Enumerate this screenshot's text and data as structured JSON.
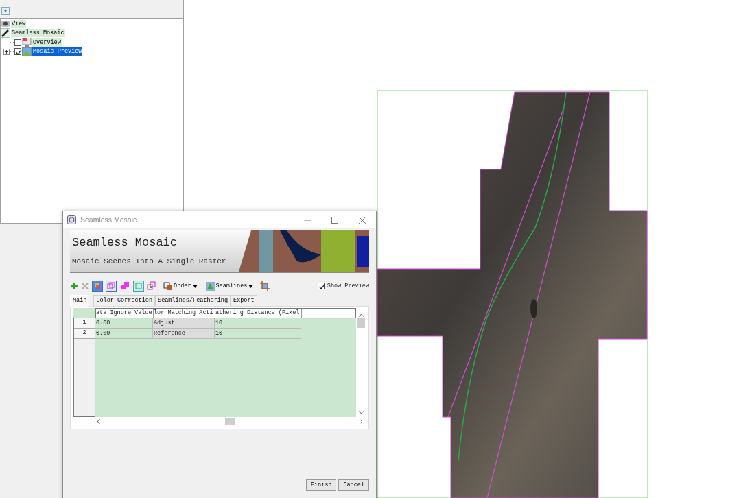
{
  "layer_manager": {
    "tree": [
      {
        "label": "View",
        "kind": "view"
      },
      {
        "label": "Seamless Mosaic",
        "kind": "tool",
        "children": [
          {
            "label": "Overview",
            "kind": "overview",
            "checked": false,
            "selected": false
          },
          {
            "label": "Mosaic Preview",
            "kind": "preview",
            "checked": true,
            "selected": true
          }
        ]
      }
    ]
  },
  "dialog": {
    "title": "Seamless Mosaic",
    "banner": {
      "title": "Seamless Mosaic",
      "subtitle": "Mosaic Scenes Into A Single Raster"
    },
    "toolbar": {
      "order_label": "Order",
      "seamlines_label": "Seamlines",
      "show_preview": {
        "label": "Show Preview",
        "checked": true
      }
    },
    "tabs": [
      {
        "label": "Main",
        "selected": true
      },
      {
        "label": "Color Correction",
        "selected": false
      },
      {
        "label": "Seamlines/Feathering",
        "selected": false
      },
      {
        "label": "Export",
        "selected": false
      }
    ],
    "table": {
      "columns": [
        "ata Ignore Value",
        "lor Matching Acti",
        "athering Distance (Pixel"
      ],
      "rows": [
        {
          "number": "1",
          "cells": [
            "0.00",
            "Adjust",
            "10"
          ]
        },
        {
          "number": "2",
          "cells": [
            "0.00",
            "Reference",
            "10"
          ]
        }
      ]
    },
    "buttons": [
      "Finish",
      "Cancel"
    ]
  }
}
